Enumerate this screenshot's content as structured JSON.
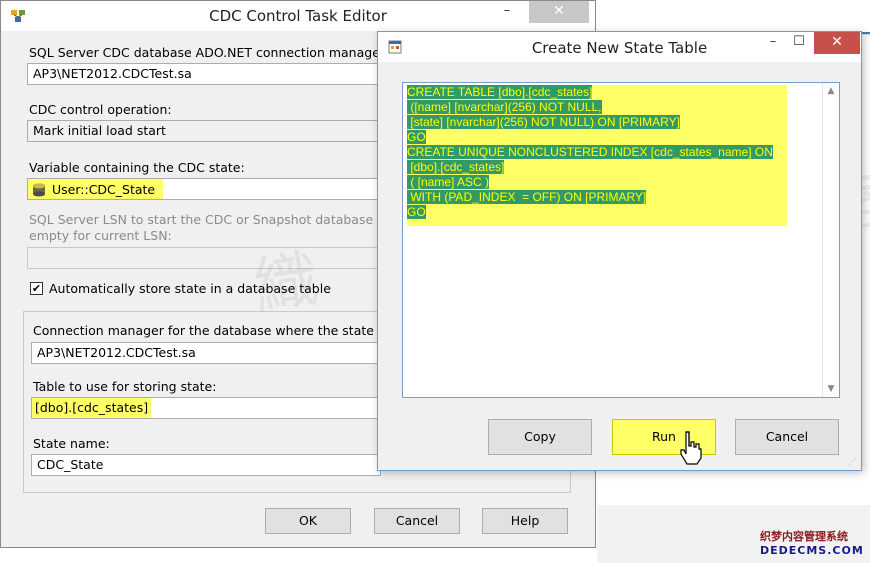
{
  "editor": {
    "title": "CDC Control Task Editor",
    "min_label": "–",
    "close_label": "✕",
    "connection_label": "SQL Server CDC database ADO.NET connection manager:",
    "connection_value": "AP3\\NET2012.CDCTest.sa",
    "operation_label": "CDC control operation:",
    "operation_value": "Mark initial load start",
    "variable_label": "Variable containing the CDC state:",
    "variable_value": "User::CDC_State",
    "lsn_label_line1": "SQL Server LSN to start the CDC or Snapshot database nam",
    "lsn_label_line2": "empty for current LSN:",
    "auto_store_label": "Automatically store state in a database table",
    "auto_store_checked": "✔",
    "state_conn_label": "Connection manager for the database where the state is sto",
    "state_conn_value": "AP3\\NET2012.CDCTest.sa",
    "table_label": "Table to use for storing state:",
    "table_value": "[dbo].[cdc_states]",
    "state_name_label": "State name:",
    "state_name_value": "CDC_State",
    "ok_label": "OK",
    "cancel_label": "Cancel",
    "help_label": "Help"
  },
  "dialog": {
    "title": "Create New State Table",
    "min_label": "–",
    "max_label": "☐",
    "close_label": "✕",
    "sql_lines": [
      "CREATE TABLE [dbo].[cdc_states]",
      " ([name] [nvarchar](256) NOT NULL,",
      " [state] [nvarchar](256) NOT NULL) ON [PRIMARY]",
      "GO",
      "CREATE UNIQUE NONCLUSTERED INDEX [cdc_states_name] ON",
      " [dbo].[cdc_states]",
      " ( [name] ASC )",
      " WITH (PAD_INDEX  = OFF) ON [PRIMARY]",
      "GO"
    ],
    "copy_label": "Copy",
    "run_label": "Run",
    "cancel_label": "Cancel"
  },
  "watermark": "織 夢 工 作 室",
  "logo": {
    "line1": "织梦内容管理系统",
    "line2": "DEDECMS.COM"
  },
  "colors": {
    "highlight": "#ffff66",
    "sql_text": "#ffff00",
    "sql_text_bg": "#339966",
    "close_button": "#c7504a"
  }
}
